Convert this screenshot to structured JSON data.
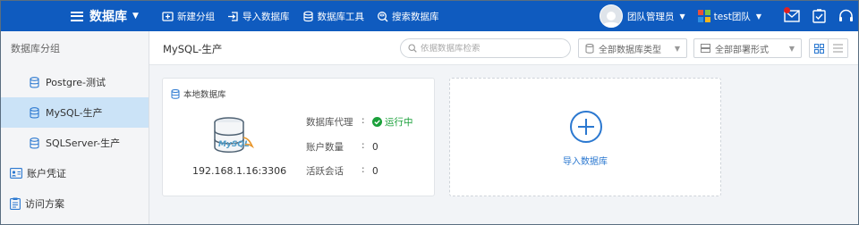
{
  "topbar": {
    "title": "数据库",
    "tools": [
      {
        "label": "新建分组",
        "icon": "new-group-icon"
      },
      {
        "label": "导入数据库",
        "icon": "import-icon"
      },
      {
        "label": "数据库工具",
        "icon": "tools-icon"
      },
      {
        "label": "搜索数据库",
        "icon": "search-db-icon"
      }
    ],
    "user": "团队管理员",
    "team": "test团队",
    "icons": [
      "mail-icon",
      "tasks-icon",
      "headset-icon"
    ]
  },
  "sidebar": {
    "header": "数据库分组",
    "groups": [
      {
        "label": "Postgre-测试",
        "active": false
      },
      {
        "label": "MySQL-生产",
        "active": true
      },
      {
        "label": "SQLServer-生产",
        "active": false
      }
    ],
    "sections": [
      {
        "label": "账户凭证",
        "icon": "credential-icon"
      },
      {
        "label": "访问方案",
        "icon": "access-plan-icon"
      }
    ]
  },
  "content": {
    "title": "MySQL-生产",
    "search_placeholder": "依据数据库检索",
    "filter_type": "全部数据库类型",
    "filter_deploy": "全部部署形式",
    "view_modes": [
      "grid-view-icon",
      "list-view-icon"
    ]
  },
  "db_card": {
    "header": "本地数据库",
    "logo_text": "MySQL",
    "ip": "192.168.1.16:3306",
    "fields": [
      {
        "key": "数据库代理",
        "value": "运行中",
        "status": "running"
      },
      {
        "key": "账户数量",
        "value": "0"
      },
      {
        "key": "活跃会话",
        "value": "0"
      }
    ]
  },
  "import_card": {
    "label": "导入数据库"
  },
  "colors": {
    "brand": "#0f5bbf",
    "active_item": "#cbe3f7",
    "running": "#1aa03a",
    "link": "#2b78d0"
  }
}
